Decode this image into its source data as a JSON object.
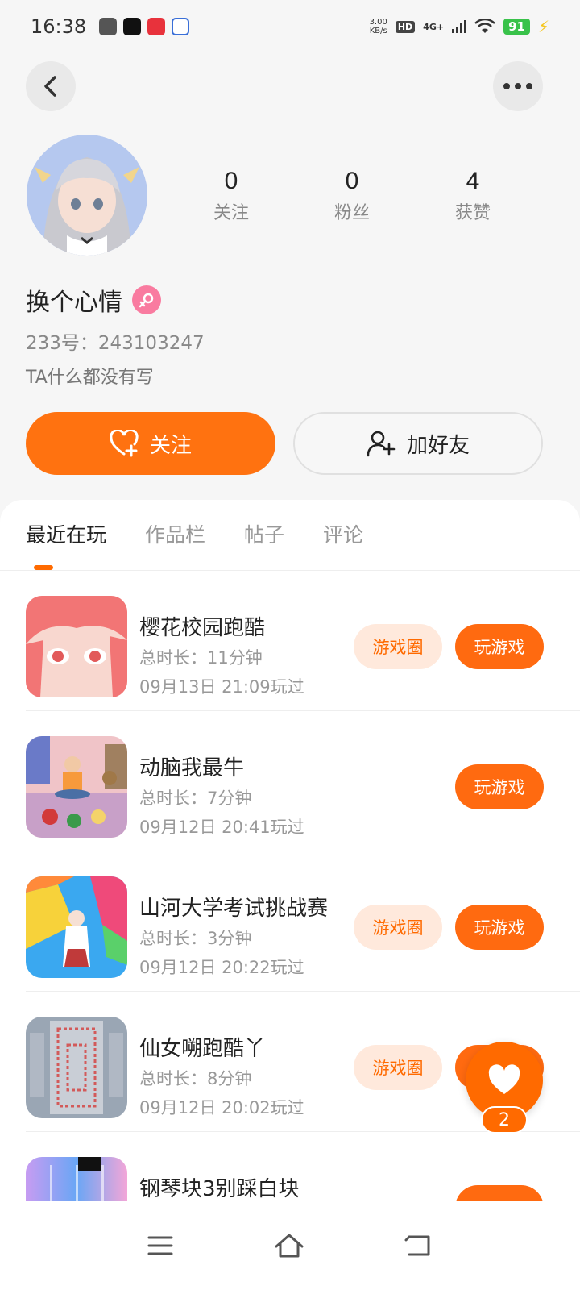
{
  "status": {
    "time": "16:38",
    "net_speed": "3.00",
    "net_unit": "KB/s",
    "hd": "HD",
    "signal": "4G+",
    "battery": "91"
  },
  "profile": {
    "following_count": "0",
    "following_label": "关注",
    "fans_count": "0",
    "fans_label": "粉丝",
    "likes_count": "4",
    "likes_label": "获赞",
    "username": "换个心情",
    "user_id": "233号：243103247",
    "bio": "TA什么都没有写"
  },
  "actions": {
    "follow_label": "关注",
    "add_friend_label": "加好友"
  },
  "tabs": [
    {
      "label": "最近在玩"
    },
    {
      "label": "作品栏"
    },
    {
      "label": "帖子"
    },
    {
      "label": "评论"
    }
  ],
  "games": [
    {
      "title": "樱花校园跑酷",
      "duration": "总时长：11分钟",
      "last_played": "09月13日 21:09玩过",
      "circle_label": "游戏圈",
      "play_label": "玩游戏"
    },
    {
      "title": "动脑我最牛",
      "duration": "总时长：7分钟",
      "last_played": "09月12日 20:41玩过",
      "play_label": "玩游戏"
    },
    {
      "title": "山河大学考试挑战赛",
      "duration": "总时长：3分钟",
      "last_played": "09月12日 20:22玩过",
      "circle_label": "游戏圈",
      "play_label": "玩游戏"
    },
    {
      "title": "仙女嗍跑酷丫",
      "duration": "总时长：8分钟",
      "last_played": "09月12日 20:02玩过",
      "circle_label": "游戏圈",
      "play_label": "玩游戏"
    },
    {
      "title": "钢琴块3别踩白块"
    }
  ],
  "floating_like": {
    "count": "2"
  },
  "colors": {
    "accent": "#ff6a00",
    "accent_light": "#ffe9dc",
    "female": "#f97ba0"
  }
}
